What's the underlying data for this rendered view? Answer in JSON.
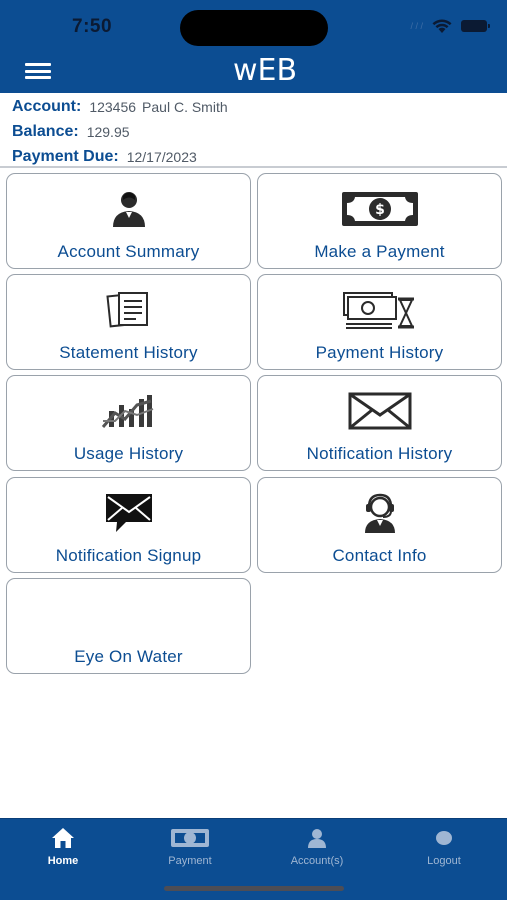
{
  "status_bar": {
    "time": "7:50",
    "carrier": "/ / /"
  },
  "header": {
    "logo": "wEB"
  },
  "account": {
    "account_label": "Account:",
    "account_number": "123456",
    "account_name": "Paul C. Smith",
    "balance_label": "Balance:",
    "balance_value": "129.95",
    "due_label": "Payment Due:",
    "due_value": "12/17/2023"
  },
  "tiles": [
    {
      "label": "Account Summary",
      "icon": "person-icon"
    },
    {
      "label": "Make a Payment",
      "icon": "dollar-bill-icon"
    },
    {
      "label": "Statement History",
      "icon": "documents-icon"
    },
    {
      "label": "Payment History",
      "icon": "money-hourglass-icon"
    },
    {
      "label": "Usage History",
      "icon": "usage-chart-icon"
    },
    {
      "label": "Notification History",
      "icon": "envelope-icon"
    },
    {
      "label": "Notification Signup",
      "icon": "message-envelope-icon"
    },
    {
      "label": "Contact Info",
      "icon": "support-agent-icon"
    },
    {
      "label": "Eye On Water",
      "icon": ""
    }
  ],
  "tabbar": [
    {
      "label": "Home",
      "icon": "home-icon",
      "active": true
    },
    {
      "label": "Payment",
      "icon": "money-icon",
      "active": false
    },
    {
      "label": "Account(s)",
      "icon": "user-icon",
      "active": false
    },
    {
      "label": "Logout",
      "icon": "circle-icon",
      "active": false
    }
  ],
  "colors": {
    "primary": "#0c4d92",
    "label_text": "#0c4d92",
    "tile_border": "#9aa2ab"
  }
}
